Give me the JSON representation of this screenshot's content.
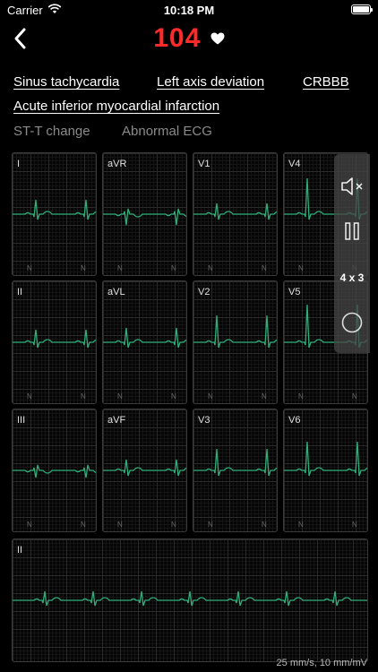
{
  "status_bar": {
    "carrier": "Carrier",
    "time": "10:18 PM"
  },
  "header": {
    "heart_rate": "104"
  },
  "diagnoses": [
    "Sinus tachycardia",
    "Left axis deviation",
    "CRBBB",
    "Acute inferior myocardial infarction"
  ],
  "secondary_findings": [
    "ST-T change",
    "Abnormal ECG"
  ],
  "leads": [
    {
      "label": "I"
    },
    {
      "label": "aVR"
    },
    {
      "label": "V1"
    },
    {
      "label": "V4"
    },
    {
      "label": "II"
    },
    {
      "label": "aVL"
    },
    {
      "label": "V2"
    },
    {
      "label": "V5"
    },
    {
      "label": "III"
    },
    {
      "label": "aVF"
    },
    {
      "label": "V3"
    },
    {
      "label": "V6"
    }
  ],
  "beat_marker": "N",
  "rhythm_strip": {
    "label": "II"
  },
  "scale_text": "25 mm/s,  10 mm/mV",
  "side_controls": {
    "layout_label": "4 x 3"
  },
  "colors": {
    "trace": "#2fae7a",
    "heart_rate": "#ff2a2a",
    "background": "#000000"
  }
}
